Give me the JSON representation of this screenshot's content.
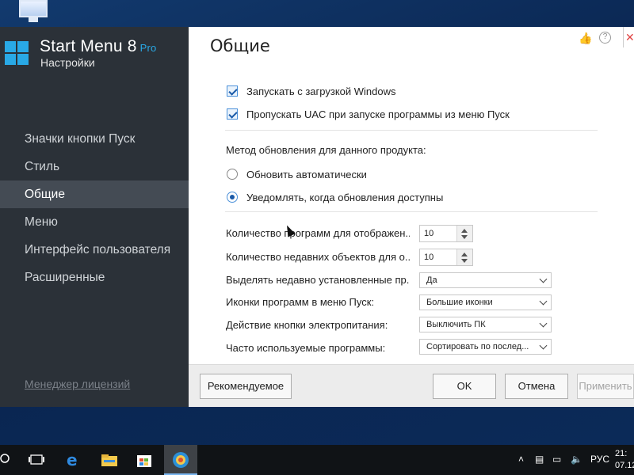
{
  "app": {
    "name": "Start Menu 8",
    "edition": "Pro",
    "subtitle": "Настройки"
  },
  "sidebar": {
    "items": [
      {
        "label": "Значки кнопки Пуск",
        "active": false
      },
      {
        "label": "Стиль",
        "active": false
      },
      {
        "label": "Общие",
        "active": true
      },
      {
        "label": "Меню",
        "active": false
      },
      {
        "label": "Интерфейс пользователя",
        "active": false
      },
      {
        "label": "Расширенные",
        "active": false
      }
    ],
    "license_link": "Менеджер лицензий"
  },
  "page": {
    "title": "Общие",
    "checkboxes": [
      {
        "label": "Запускать с загрузкой Windows",
        "checked": true
      },
      {
        "label": "Пропускать UAC при запуске программы из меню Пуск",
        "checked": true
      }
    ],
    "update_method_label": "Метод обновления для данного продукта:",
    "update_options": [
      {
        "label": "Обновить автоматически",
        "selected": false
      },
      {
        "label": "Уведомлять, когда обновления доступны",
        "selected": true
      }
    ],
    "settings": {
      "programs_count_label": "Количество программ для отображен...",
      "programs_count_value": "10",
      "recent_count_label": "Количество недавних объектов для о...",
      "recent_count_value": "10",
      "highlight_label": "Выделять недавно установленные пр...",
      "highlight_value": "Да",
      "icons_label": "Иконки программ в меню Пуск:",
      "icons_value": "Большие иконки",
      "power_label": "Действие кнопки электропитания:",
      "power_value": "Выключить ПК",
      "frequent_label": "Часто используемые программы:",
      "frequent_value": "Сортировать по послед..."
    }
  },
  "footer": {
    "recommended": "Рекомендуемое",
    "ok": "OK",
    "cancel": "Отмена",
    "apply": "Применить"
  },
  "taskbar": {
    "language": "РУС",
    "time": "21:",
    "date": "07.12"
  },
  "colors": {
    "accent": "#29a9e6",
    "sidebar_bg": "#2b3138",
    "sidebar_active": "#444b54"
  }
}
